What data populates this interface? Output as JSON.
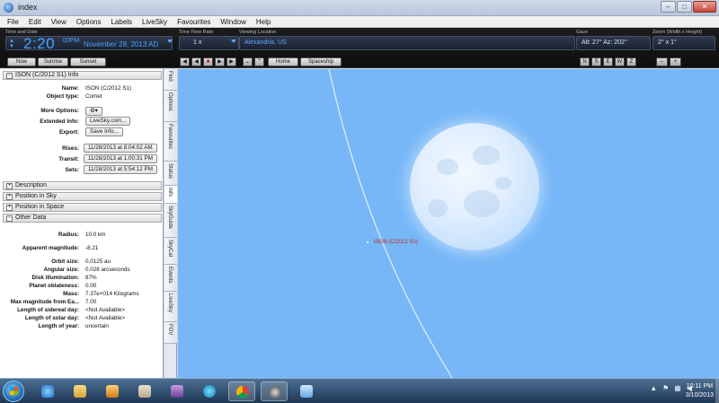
{
  "window": {
    "title": "index",
    "buttons": {
      "minimize": "–",
      "maximize": "□",
      "close": "✕"
    }
  },
  "menu": [
    "File",
    "Edit",
    "View",
    "Options",
    "Labels",
    "LiveSky",
    "Favourites",
    "Window",
    "Help"
  ],
  "toolbar": {
    "time_label": "Time and Date",
    "time": "2:20",
    "ampm": "00PM",
    "date": "November 28, 2013 AD",
    "flow_label": "Time Flow Rate",
    "flow": "1 x",
    "location_label": "Viewing Location",
    "location": "Alexandria, US",
    "gaze_label": "Gaze",
    "gaze": "Alt: 27° Az: 202°",
    "zoom_label": "Zoom (Width x Height)",
    "zoom": "2° x 1°",
    "now": "Now",
    "sunrise": "Sunrise",
    "sunset": "Sunset",
    "home": "Home",
    "spaceship": "Spaceship",
    "dirs": [
      "N",
      "S",
      "E",
      "W",
      "Z"
    ],
    "zoom_out": "–",
    "zoom_in": "+"
  },
  "info": {
    "header": "ISON (C/2012 S1) Info",
    "name_label": "Name:",
    "name": "ISON (C/2012 S1)",
    "type_label": "Object type:",
    "type": "Comet",
    "more_label": "More Options:",
    "more": "⚙▾",
    "ext_label": "Extended Info:",
    "ext": "LiveSky.com...",
    "export_label": "Export:",
    "export": "Save Info...",
    "rises_label": "Rises:",
    "rises": "11/28/2013 at 8:04:02 AM",
    "transit_label": "Transit:",
    "transit": "11/28/2013 at 1:00:31 PM",
    "sets_label": "Sets:",
    "sets": "11/28/2013 at 5:54:12 PM"
  },
  "sections": {
    "description": "Description",
    "position_sky": "Position in Sky",
    "position_space": "Position in Space",
    "other_data": "Other Data"
  },
  "other": {
    "radius_label": "Radius:",
    "radius": "10.0 km",
    "appmag_label": "Apparent magnitude:",
    "appmag": "-8.21",
    "orbit_label": "Orbit size:",
    "orbit": "0.0125 au",
    "angular_label": "Angular size:",
    "angular": "0.028 arcseconds",
    "disk_label": "Disk illumination:",
    "disk": "87%",
    "obl_label": "Planet oblateness:",
    "obl": "0.00",
    "mass_label": "Mass:",
    "mass": "7.37e+014 Kilograms",
    "maxmag_label": "Max magnitude from Ea...",
    "maxmag": "7.00",
    "sidereal_label": "Length of sidereal day:",
    "sidereal": "<Not Available>",
    "solar_label": "Length of solar day:",
    "solar": "<Not Available>",
    "year_label": "Length of year:",
    "year": "uncertain"
  },
  "vtabs": [
    "Find",
    "Options",
    "Favourites",
    "Status",
    "Info",
    "SkyGuide",
    "SkyCal",
    "Events",
    "LiveSky",
    "FOV"
  ],
  "sky": {
    "object_label": "ISON (C/2012 S1)"
  },
  "taskbar": {
    "time": "10:11 PM",
    "date": "3/10/2013"
  },
  "colors": {
    "sky": "#77b7f7",
    "label_red": "#c0281e",
    "toolbar_text": "#4aa2ff"
  }
}
